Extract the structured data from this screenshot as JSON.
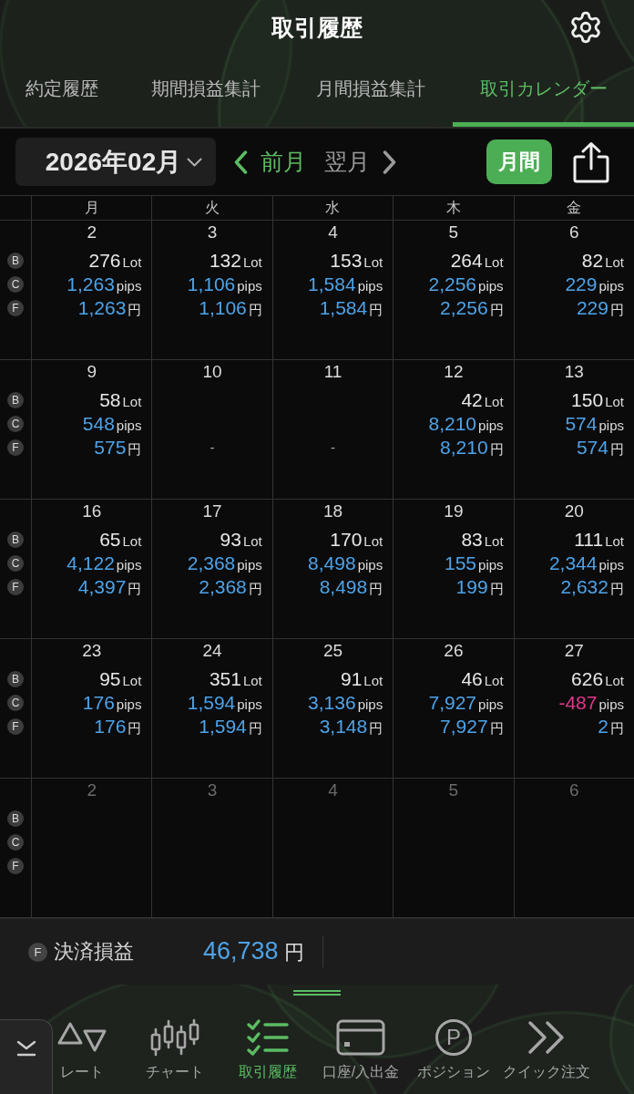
{
  "header": {
    "title": "取引履歴"
  },
  "tabs": [
    {
      "label": "約定履歴",
      "selected": false
    },
    {
      "label": "期間損益集計",
      "selected": false
    },
    {
      "label": "月間損益集計",
      "selected": false
    },
    {
      "label": "取引カレンダー",
      "selected": true
    }
  ],
  "toolbar": {
    "month": "2026年02月",
    "prev": {
      "label": "前月",
      "disabled": false
    },
    "next": {
      "label": "翌月",
      "disabled": true
    },
    "period_button": {
      "label": "月間",
      "selected": true
    }
  },
  "calendar": {
    "weekdays": [
      "月",
      "火",
      "水",
      "木",
      "金"
    ],
    "weeks": [
      {
        "labels": [
          "B",
          "C",
          "F"
        ],
        "days": [
          {
            "date": "2",
            "kind": "data",
            "lot": {
              "value": "276",
              "unit": "Lot"
            },
            "pips": {
              "value": "1,263",
              "unit": "pips",
              "negative": false
            },
            "yen": {
              "value": "1,263",
              "unit": "円",
              "negative": false
            }
          },
          {
            "date": "3",
            "kind": "data",
            "lot": {
              "value": "132",
              "unit": "Lot"
            },
            "pips": {
              "value": "1,106",
              "unit": "pips",
              "negative": false
            },
            "yen": {
              "value": "1,106",
              "unit": "円",
              "negative": false
            }
          },
          {
            "date": "4",
            "kind": "data",
            "lot": {
              "value": "153",
              "unit": "Lot"
            },
            "pips": {
              "value": "1,584",
              "unit": "pips",
              "negative": false
            },
            "yen": {
              "value": "1,584",
              "unit": "円",
              "negative": false
            }
          },
          {
            "date": "5",
            "kind": "data",
            "lot": {
              "value": "264",
              "unit": "Lot"
            },
            "pips": {
              "value": "2,256",
              "unit": "pips",
              "negative": false
            },
            "yen": {
              "value": "2,256",
              "unit": "円",
              "negative": false
            }
          },
          {
            "date": "6",
            "kind": "data",
            "lot": {
              "value": "82",
              "unit": "Lot"
            },
            "pips": {
              "value": "229",
              "unit": "pips",
              "negative": false
            },
            "yen": {
              "value": "229",
              "unit": "円",
              "negative": false
            }
          }
        ]
      },
      {
        "labels": [
          "B",
          "C",
          "F"
        ],
        "days": [
          {
            "date": "9",
            "kind": "data",
            "lot": {
              "value": "58",
              "unit": "Lot"
            },
            "pips": {
              "value": "548",
              "unit": "pips",
              "negative": false
            },
            "yen": {
              "value": "575",
              "unit": "円",
              "negative": false
            }
          },
          {
            "date": "10",
            "kind": "empty",
            "dash": "-"
          },
          {
            "date": "11",
            "kind": "empty",
            "dash": "-"
          },
          {
            "date": "12",
            "kind": "data",
            "lot": {
              "value": "42",
              "unit": "Lot"
            },
            "pips": {
              "value": "8,210",
              "unit": "pips",
              "negative": false
            },
            "yen": {
              "value": "8,210",
              "unit": "円",
              "negative": false
            }
          },
          {
            "date": "13",
            "kind": "data",
            "lot": {
              "value": "150",
              "unit": "Lot"
            },
            "pips": {
              "value": "574",
              "unit": "pips",
              "negative": false
            },
            "yen": {
              "value": "574",
              "unit": "円",
              "negative": false
            }
          }
        ]
      },
      {
        "labels": [
          "B",
          "C",
          "F"
        ],
        "days": [
          {
            "date": "16",
            "kind": "data",
            "lot": {
              "value": "65",
              "unit": "Lot"
            },
            "pips": {
              "value": "4,122",
              "unit": "pips",
              "negative": false
            },
            "yen": {
              "value": "4,397",
              "unit": "円",
              "negative": false
            }
          },
          {
            "date": "17",
            "kind": "data",
            "lot": {
              "value": "93",
              "unit": "Lot"
            },
            "pips": {
              "value": "2,368",
              "unit": "pips",
              "negative": false
            },
            "yen": {
              "value": "2,368",
              "unit": "円",
              "negative": false
            }
          },
          {
            "date": "18",
            "kind": "data",
            "lot": {
              "value": "170",
              "unit": "Lot"
            },
            "pips": {
              "value": "8,498",
              "unit": "pips",
              "negative": false
            },
            "yen": {
              "value": "8,498",
              "unit": "円",
              "negative": false
            }
          },
          {
            "date": "19",
            "kind": "data",
            "lot": {
              "value": "83",
              "unit": "Lot"
            },
            "pips": {
              "value": "155",
              "unit": "pips",
              "negative": false
            },
            "yen": {
              "value": "199",
              "unit": "円",
              "negative": false
            }
          },
          {
            "date": "20",
            "kind": "data",
            "lot": {
              "value": "111",
              "unit": "Lot"
            },
            "pips": {
              "value": "2,344",
              "unit": "pips",
              "negative": false
            },
            "yen": {
              "value": "2,632",
              "unit": "円",
              "negative": false
            }
          }
        ]
      },
      {
        "labels": [
          "B",
          "C",
          "F"
        ],
        "days": [
          {
            "date": "23",
            "kind": "data",
            "lot": {
              "value": "95",
              "unit": "Lot"
            },
            "pips": {
              "value": "176",
              "unit": "pips",
              "negative": false
            },
            "yen": {
              "value": "176",
              "unit": "円",
              "negative": false
            }
          },
          {
            "date": "24",
            "kind": "data",
            "lot": {
              "value": "351",
              "unit": "Lot"
            },
            "pips": {
              "value": "1,594",
              "unit": "pips",
              "negative": false
            },
            "yen": {
              "value": "1,594",
              "unit": "円",
              "negative": false
            }
          },
          {
            "date": "25",
            "kind": "data",
            "lot": {
              "value": "91",
              "unit": "Lot"
            },
            "pips": {
              "value": "3,136",
              "unit": "pips",
              "negative": false
            },
            "yen": {
              "value": "3,148",
              "unit": "円",
              "negative": false
            }
          },
          {
            "date": "26",
            "kind": "data",
            "lot": {
              "value": "46",
              "unit": "Lot"
            },
            "pips": {
              "value": "7,927",
              "unit": "pips",
              "negative": false
            },
            "yen": {
              "value": "7,927",
              "unit": "円",
              "negative": false
            }
          },
          {
            "date": "27",
            "kind": "data",
            "lot": {
              "value": "626",
              "unit": "Lot"
            },
            "pips": {
              "value": "-487",
              "unit": "pips",
              "negative": true
            },
            "yen": {
              "value": "2",
              "unit": "円",
              "negative": false
            }
          }
        ]
      },
      {
        "labels": [
          "B",
          "C",
          "F"
        ],
        "days": [
          {
            "date": "2",
            "kind": "outside"
          },
          {
            "date": "3",
            "kind": "outside"
          },
          {
            "date": "4",
            "kind": "outside"
          },
          {
            "date": "5",
            "kind": "outside"
          },
          {
            "date": "6",
            "kind": "outside"
          }
        ]
      }
    ]
  },
  "summary": {
    "badge": "F",
    "label": "決済損益",
    "value": "46,738",
    "unit": "円"
  },
  "navigation": {
    "items": [
      {
        "kind": "rate",
        "label": "レート",
        "selected": false
      },
      {
        "kind": "chart",
        "label": "チャート",
        "selected": false
      },
      {
        "kind": "history",
        "label": "取引履歴",
        "selected": true
      },
      {
        "kind": "account",
        "label": "口座/入出金",
        "selected": false
      },
      {
        "kind": "position",
        "label": "ポジション",
        "selected": false,
        "icon_glyph": "P"
      },
      {
        "kind": "quick_order",
        "label": "クイック注文",
        "selected": false
      }
    ]
  }
}
